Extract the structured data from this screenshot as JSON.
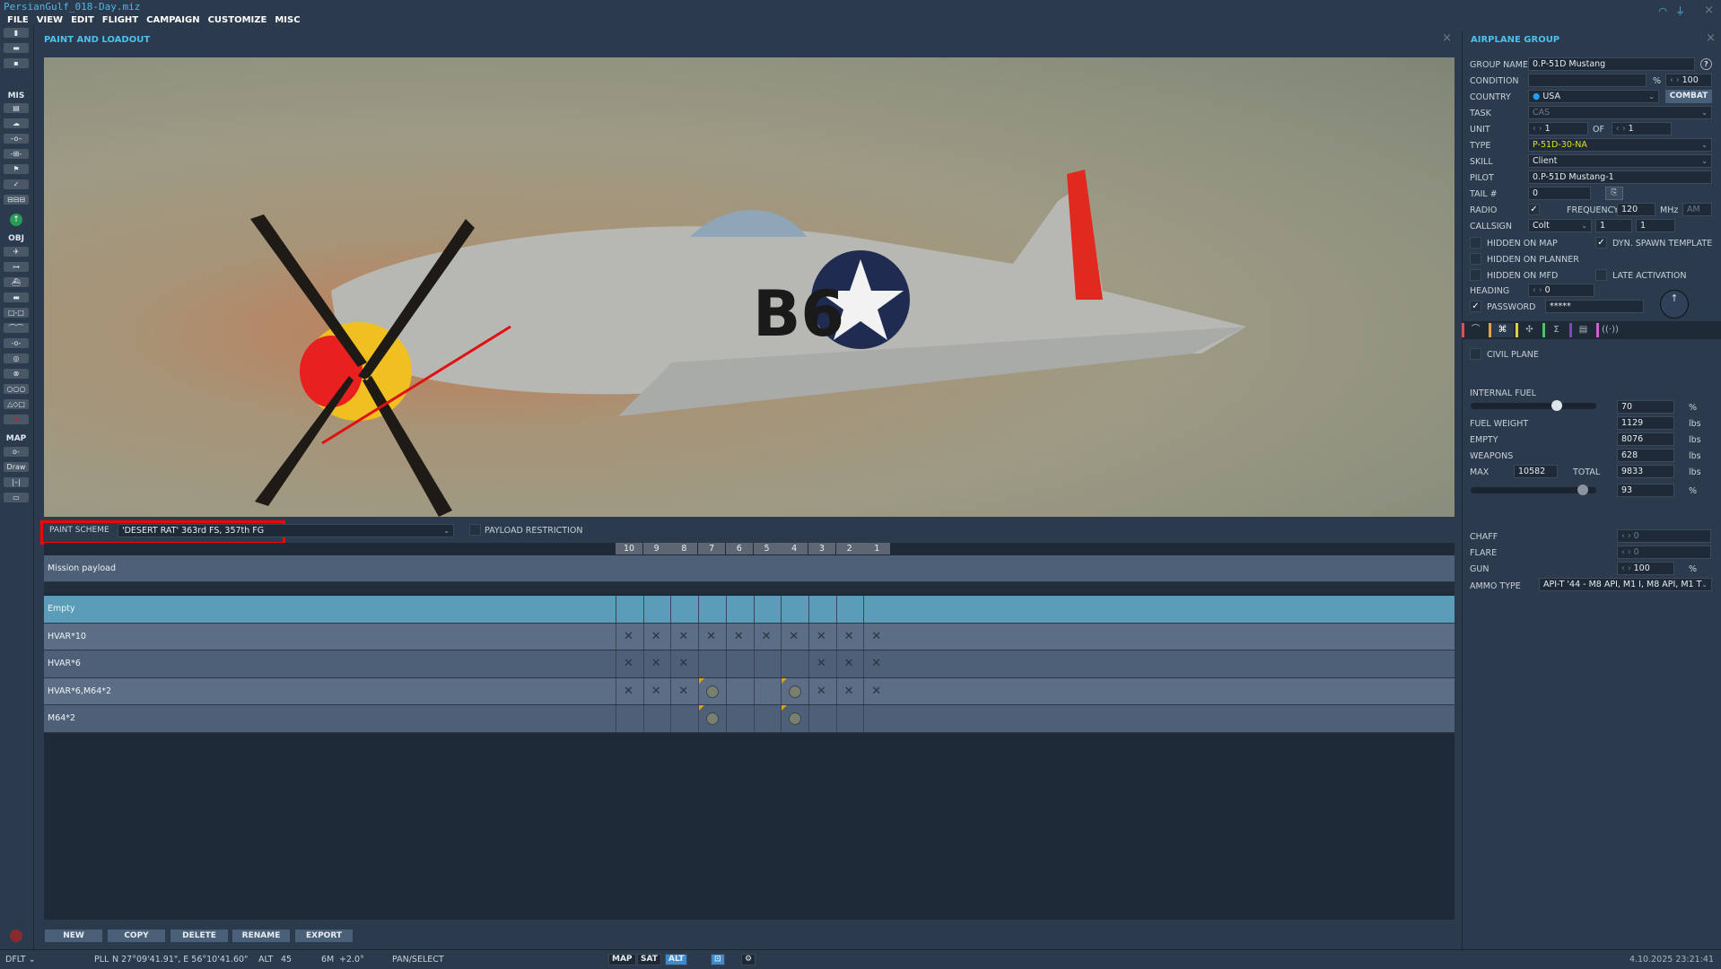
{
  "window_title": "PersianGulf_018-Day.miz",
  "menu": [
    "FILE",
    "VIEW",
    "EDIT",
    "FLIGHT",
    "CAMPAIGN",
    "CUSTOMIZE",
    "MISC"
  ],
  "toolbar": {
    "mis_label": "MIS",
    "obj_label": "OBJ",
    "map_label": "MAP",
    "draw_label": "Draw"
  },
  "paint_panel": {
    "title": "PAINT AND LOADOUT",
    "paint_scheme_label": "PAINT SCHEME",
    "paint_scheme_value": "'DESERT RAT' 363rd FS, 357th FG",
    "payload_restriction_label": "PAYLOAD RESTRICTION",
    "payload_restriction_checked": false,
    "stations": [
      "10",
      "9",
      "8",
      "7",
      "6",
      "5",
      "4",
      "3",
      "2",
      "1"
    ],
    "mission_payload_label": "Mission payload",
    "loadouts": [
      {
        "name": "Empty",
        "selected": true,
        "stations": []
      },
      {
        "name": "HVAR*10",
        "stations": [
          "10",
          "9",
          "8",
          "7",
          "6",
          "5",
          "4",
          "3",
          "2",
          "1"
        ],
        "bombs": []
      },
      {
        "name": "HVAR*6",
        "stations": [
          "10",
          "9",
          "8",
          "3",
          "2",
          "1"
        ],
        "bombs": []
      },
      {
        "name": "HVAR*6,M64*2",
        "stations": [
          "10",
          "9",
          "8",
          "3",
          "2",
          "1"
        ],
        "bombs": [
          "7",
          "4"
        ]
      },
      {
        "name": "M64*2",
        "stations": [],
        "bombs": [
          "7",
          "4"
        ]
      }
    ],
    "buttons": {
      "new": "NEW",
      "copy": "COPY",
      "delete": "DELETE",
      "rename": "RENAME",
      "export": "EXPORT"
    }
  },
  "group": {
    "title": "AIRPLANE GROUP",
    "labels": {
      "group_name": "GROUP NAME",
      "condition": "CONDITION",
      "country": "COUNTRY",
      "task": "TASK",
      "unit": "UNIT",
      "of": "OF",
      "type": "TYPE",
      "skill": "SKILL",
      "pilot": "PILOT",
      "tail": "TAIL #",
      "radio": "RADIO",
      "frequency": "FREQUENCY",
      "mhz": "MHz",
      "callsign": "CALLSIGN",
      "hidden_map": "HIDDEN ON MAP",
      "dyn_spawn": "DYN. SPAWN TEMPLATE",
      "hidden_planner": "HIDDEN ON PLANNER",
      "hidden_mfd": "HIDDEN ON MFD",
      "late_activation": "LATE ACTIVATION",
      "heading": "HEADING",
      "password": "PASSWORD",
      "civil_plane": "CIVIL PLANE",
      "percent": "%"
    },
    "group_name": "0.P-51D Mustang",
    "condition": "100",
    "country": "USA",
    "combat_button": "COMBAT",
    "task": "CAS",
    "unit": "1",
    "unit_of": "1",
    "type": "P-51D-30-NA",
    "skill": "Client",
    "pilot": "0.P-51D Mustang-1",
    "tail": "0",
    "radio_checked": true,
    "frequency": "120",
    "modulation": "AM",
    "callsign": "Colt",
    "callsign_n1": "1",
    "callsign_n2": "1",
    "dyn_spawn_checked": true,
    "heading": "0",
    "password_checked": true,
    "password": "*****",
    "tab_colors": [
      "#e05050",
      "#e8a040",
      "#e0d040",
      "#50c060",
      "#8040d0",
      "#d060d0"
    ]
  },
  "weights": {
    "internal_fuel_label": "INTERNAL FUEL",
    "internal_fuel": "70",
    "fuel_weight_label": "FUEL WEIGHT",
    "fuel_weight": "1129",
    "empty_label": "EMPTY",
    "empty": "8076",
    "weapons_label": "WEAPONS",
    "weapons": "628",
    "max_label": "MAX",
    "max": "10582",
    "total_label": "TOTAL",
    "total": "9833",
    "total_pct": "93",
    "unit": "lbs",
    "chaff_label": "CHAFF",
    "chaff": "0",
    "flare_label": "FLARE",
    "flare": "0",
    "gun_label": "GUN",
    "gun": "100",
    "ammo_label": "AMMO TYPE",
    "ammo": "API-T '44 - M8 API, M1 I, M8 API, M1 T"
  },
  "status": {
    "profile": "DFLT",
    "coord_label": "PLL",
    "coords": "N 27°09'41.91\", E 56°10'41.60\"",
    "alt_label": "ALT",
    "alt": "45",
    "wind": "6M",
    "wind_val": "+2.0°",
    "mode": "PAN/SELECT",
    "map": "MAP",
    "sat": "SAT",
    "alt_btn": "ALT",
    "datetime": "4.10.2025 23:21:41"
  }
}
